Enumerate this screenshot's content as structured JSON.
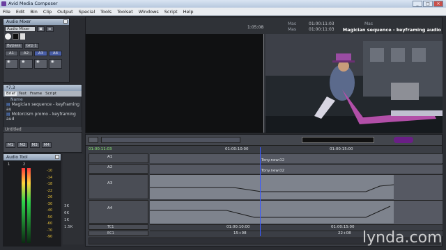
{
  "window": {
    "title": "Avid Media Composer",
    "controls": [
      "_",
      "□",
      "×"
    ]
  },
  "menu": [
    "File",
    "Edit",
    "Bin",
    "Clip",
    "Output",
    "Special",
    "Tools",
    "Toolset",
    "Windows",
    "Script",
    "Help"
  ],
  "audio_mixer": {
    "title": "Audio Mixer",
    "mode": "Audio Mixer",
    "bypass": "Bypass",
    "group": "Grp 1",
    "tracks": [
      "A1",
      "A2",
      "A3",
      "A4"
    ],
    "gains": [
      "M1",
      "M2",
      "M3",
      "M4"
    ]
  },
  "bin": {
    "title": "*7.3",
    "tabs": [
      "Brief",
      "Text",
      "Frame",
      "Script"
    ],
    "column": "Name",
    "items": [
      "Magician sequence - keyframing au",
      "Motorcism promo - keyframing aud"
    ],
    "footer": "Untitled"
  },
  "audio_tool": {
    "title": "Audio Tool",
    "channels": [
      "1",
      "2"
    ],
    "scale": [
      "-10",
      "-14",
      "-18",
      "-22",
      "-26",
      "-30",
      "-40",
      "-50",
      "-60",
      "-70",
      "-90"
    ]
  },
  "monitor": {
    "source_tc": "1:05:08",
    "mas_label_1": "Mas",
    "mas_tc_1": "01:00:11:03",
    "mas_label_2": "Mas",
    "mas_tc_2": "01:00:11:03",
    "sequence_name": "Magician sequence - keyframing audio",
    "record_tc_label": "Mas"
  },
  "timeline": {
    "current_tc": "01:00:11:03",
    "ruler_labels": [
      "01:00:10:00",
      "01:00:15:00"
    ],
    "tracks": [
      {
        "name": "A1",
        "clip": "Tony.new.02"
      },
      {
        "name": "A2",
        "clip": "Tony.new.02"
      },
      {
        "name": "A3",
        "clip": ""
      },
      {
        "name": "A4",
        "clip": ""
      }
    ],
    "tc_rows": [
      {
        "name": "TC1",
        "values": [
          "01:00:10:00",
          "01:00:15:00"
        ]
      },
      {
        "name": "EC1",
        "values": [
          "15+08",
          "22+08"
        ]
      }
    ],
    "side_labels": [
      "3K",
      "6K",
      "1K",
      "1.5K"
    ]
  },
  "watermark": "lynda.com"
}
